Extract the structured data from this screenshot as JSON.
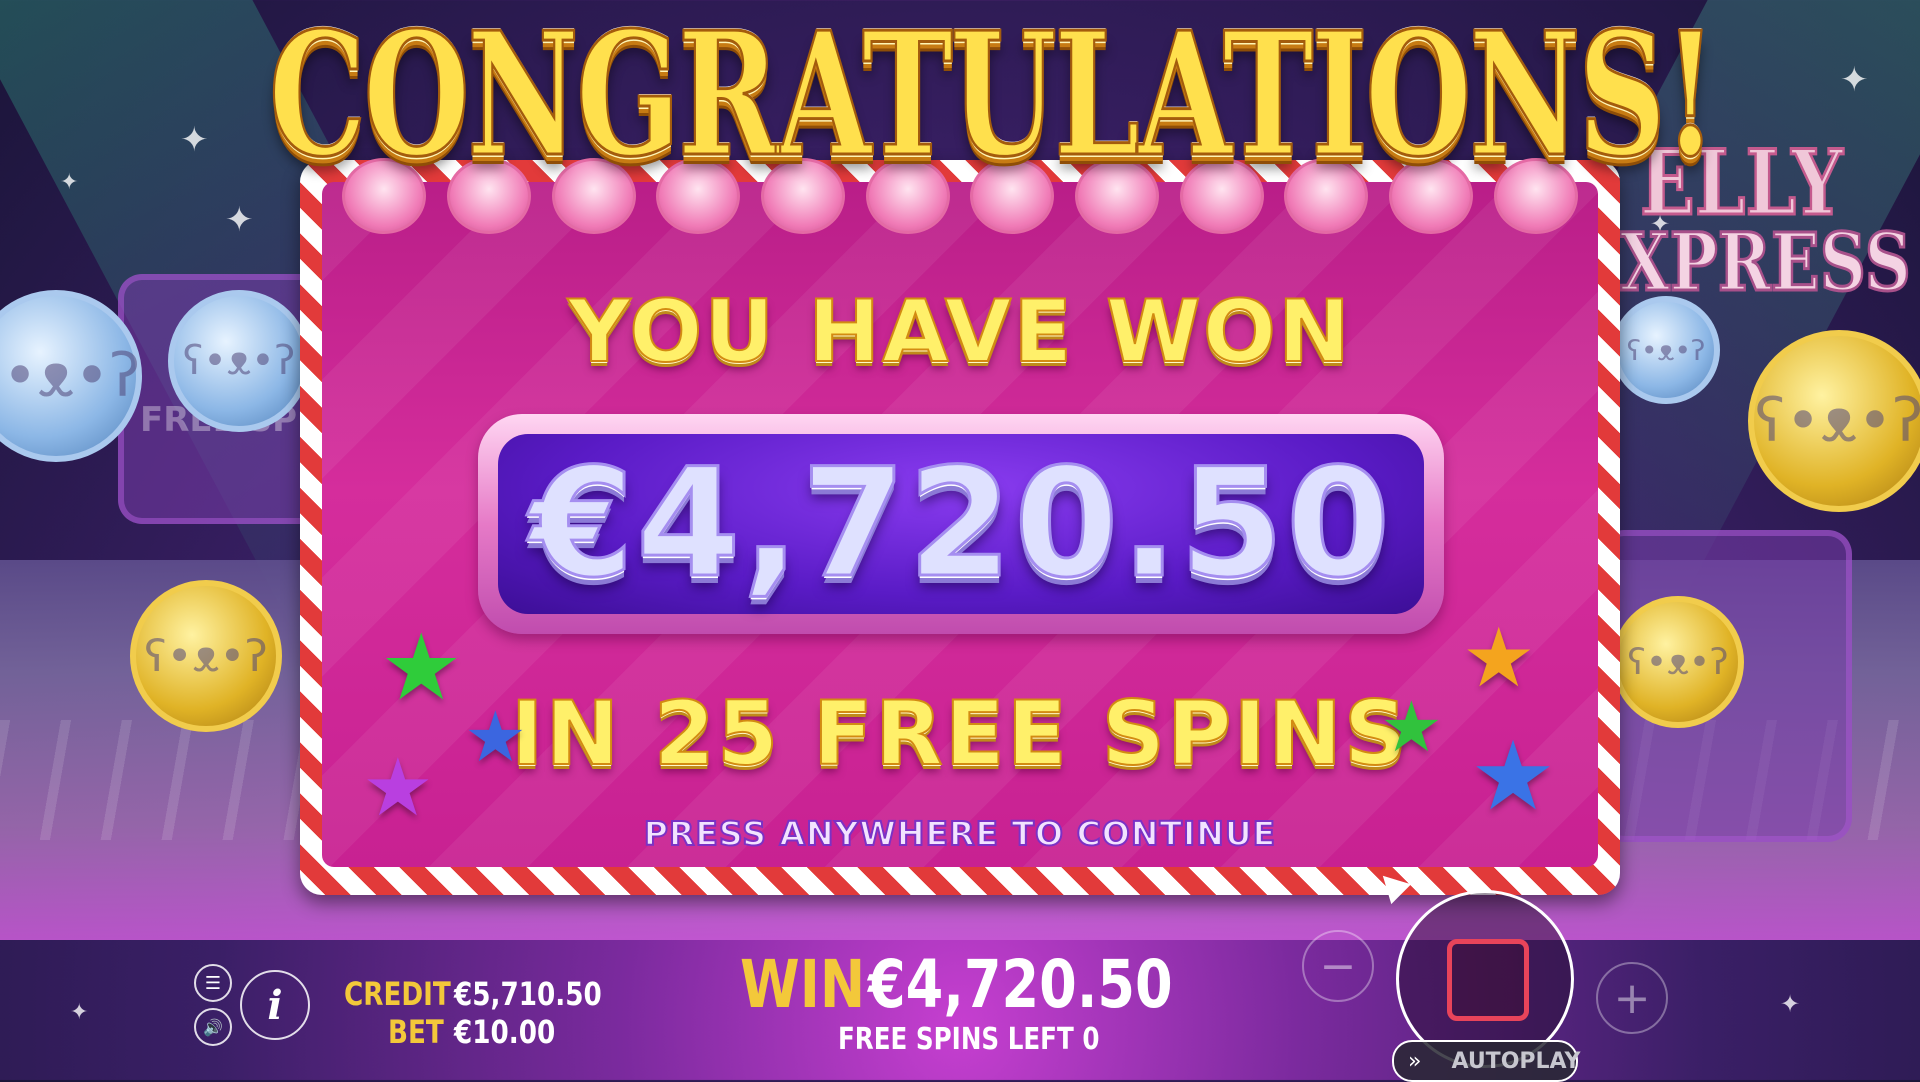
{
  "game": {
    "background_logo_fragments": [
      "ELLY",
      "XPRESS"
    ],
    "background_free_spins_fragment": "FREE SP"
  },
  "popup": {
    "title": "CONGRATULATIONS!",
    "won_label": "YOU HAVE WON",
    "amount": "€4,720.50",
    "spins_label": "IN 25 FREE SPINS",
    "continue_prompt": "PRESS ANYWHERE TO CONTINUE",
    "stars": [
      "green-star-icon",
      "blue-star-icon",
      "purple-star-icon",
      "orange-star-icon",
      "green-star-icon",
      "blue-star-icon"
    ]
  },
  "hud": {
    "credit_label": "CREDIT",
    "credit_value": "€5,710.50",
    "bet_label": "BET",
    "bet_value": "€10.00",
    "win_label": "WIN",
    "win_value": "€4,720.50",
    "free_spins_left": "FREE SPINS LEFT 0",
    "autoplay_label": "AUTOPLAY",
    "menu_icon": "menu-icon",
    "sound_icon": "speaker-icon",
    "info_icon": "info-icon",
    "minus_icon": "minus-icon",
    "plus_icon": "plus-icon",
    "stop_icon": "stop-square-icon"
  },
  "colors": {
    "title_gold": "#ffe04d",
    "panel_pink": "#d52d9c",
    "amount_purple": "#5a1bc6",
    "hud_yellow": "#f3c83a",
    "stop_red": "#e8445a"
  }
}
